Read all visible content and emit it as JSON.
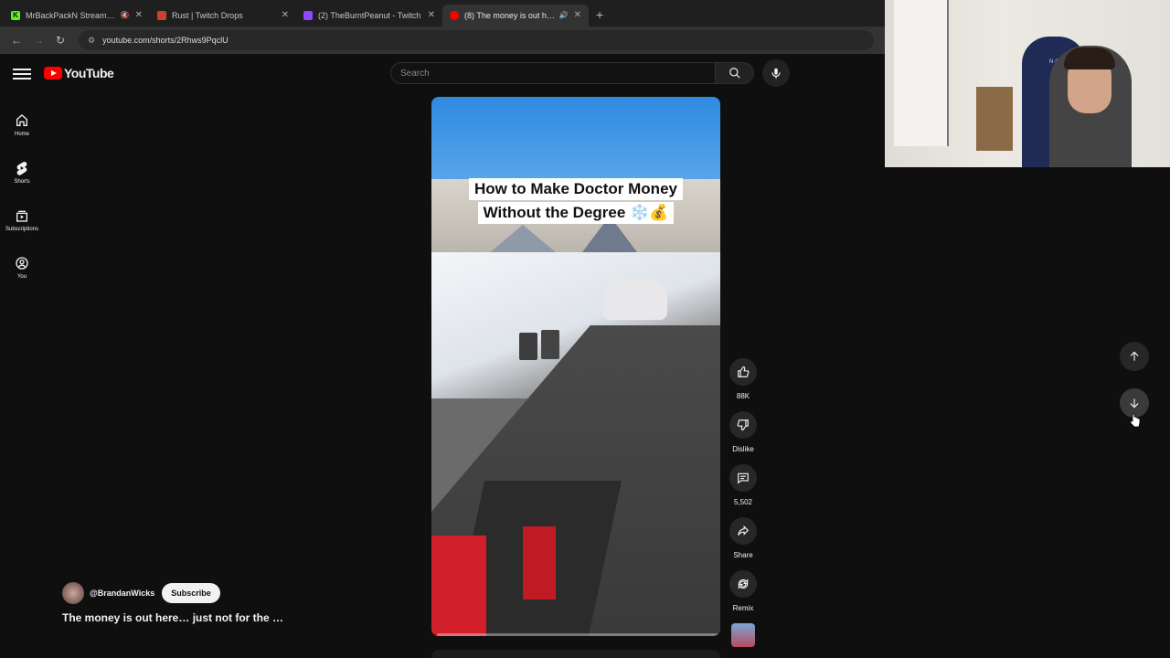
{
  "browser": {
    "tabs": [
      {
        "title": "MrBackPackN Stream - Wa",
        "favicon": "K",
        "favicon_color": "#53fc18",
        "muted": true
      },
      {
        "title": "Rust | Twitch Drops",
        "favicon": "",
        "favicon_color": "#cd412b",
        "muted": false
      },
      {
        "title": "(2) TheBurntPeanut - Twitch",
        "favicon": "",
        "favicon_color": "#9146ff",
        "muted": false
      },
      {
        "title": "(8) The money is out here...",
        "favicon": "",
        "favicon_color": "#ff0000",
        "active": true,
        "sound": true
      }
    ],
    "url": "youtube.com/shorts/2Rhws9PqclU"
  },
  "youtube": {
    "logo_text": "YouTube",
    "search_placeholder": "Search",
    "sidenav": [
      {
        "label": "Home",
        "icon": "home-icon"
      },
      {
        "label": "Shorts",
        "icon": "shorts-icon"
      },
      {
        "label": "Subscriptions",
        "icon": "subscriptions-icon"
      },
      {
        "label": "You",
        "icon": "you-icon"
      }
    ],
    "short": {
      "caption_line1": "How to Make Doctor Money",
      "caption_line2": "Without the Degree ❄️💰",
      "progress": 0.02,
      "channel_handle": "@BrandanWicks",
      "subscribe_label": "Subscribe",
      "title": "The money is out here… just not for the …"
    },
    "actions": {
      "like_count": "88K",
      "dislike_label": "Dislike",
      "comment_count": "5,502",
      "share_label": "Share",
      "remix_label": "Remix"
    }
  },
  "webcam": {
    "chair_text": "N·GEN"
  }
}
